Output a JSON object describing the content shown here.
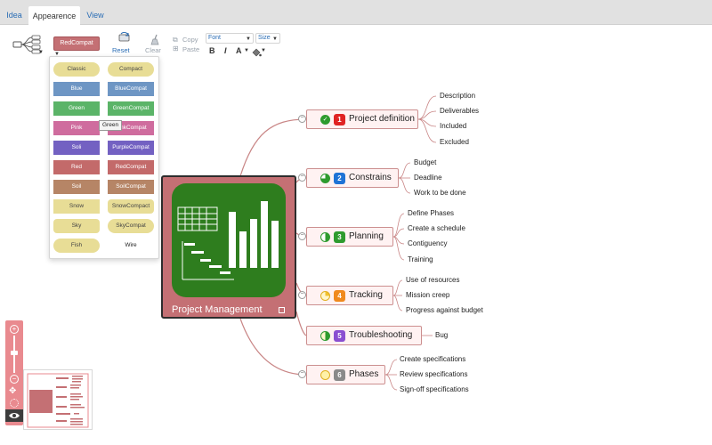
{
  "tabs": [
    {
      "label": "Idea"
    },
    {
      "label": "Appearence"
    },
    {
      "label": "View"
    }
  ],
  "toolbar": {
    "style_label": "RedCompat",
    "reset_label": "Reset",
    "clear_label": "Clear",
    "copy_label": "Copy",
    "paste_label": "Paste",
    "font_label": "Font",
    "size_label": "Size",
    "bold_label": "B",
    "italic_label": "I",
    "fontcolor_label": "A"
  },
  "palette": {
    "items": [
      {
        "label": "Classic",
        "color": "#e8dd96",
        "pill": true
      },
      {
        "label": "Compact",
        "color": "#e8dd96",
        "pill": true
      },
      {
        "label": "Blue",
        "color": "#6e96c4",
        "pill": false
      },
      {
        "label": "BlueCompat",
        "color": "#6e96c4",
        "pill": false
      },
      {
        "label": "Green",
        "color": "#5bb468",
        "pill": false
      },
      {
        "label": "GreenCompat",
        "color": "#5bb468",
        "pill": false
      },
      {
        "label": "Pink",
        "color": "#cf6c9e",
        "pill": false
      },
      {
        "label": "PinkCompat",
        "color": "#cf6c9e",
        "pill": false
      },
      {
        "label": "Soli",
        "color": "#7361c2",
        "pill": false
      },
      {
        "label": "PurpleCompat",
        "color": "#7361c2",
        "pill": false
      },
      {
        "label": "Red",
        "color": "#c36a6a",
        "pill": false
      },
      {
        "label": "RedCompat",
        "color": "#c36a6a",
        "pill": false
      },
      {
        "label": "Soil",
        "color": "#b68566",
        "pill": false
      },
      {
        "label": "SoilCompat",
        "color": "#b68566",
        "pill": false
      },
      {
        "label": "Snow",
        "color": "#e8dd96",
        "pill": false
      },
      {
        "label": "SnowCompact",
        "color": "#e8dd96",
        "pill": false
      },
      {
        "label": "Sky",
        "color": "#e8dd96",
        "pill": false
      },
      {
        "label": "SkyCompat",
        "color": "#e8dd96",
        "pill": true
      },
      {
        "label": "Fish",
        "color": "#e8dd96",
        "pill": true
      },
      {
        "label": "Wire",
        "color": "transparent",
        "pill": false
      }
    ],
    "tooltip": "Green"
  },
  "mindmap": {
    "central_title": "Project Management",
    "branches": [
      {
        "num": "1",
        "num_color": "#e02323",
        "icon": "checkmark-icon",
        "icon_color": "#2e9b2e",
        "label": "Project definition",
        "leaves": [
          "Description",
          "Deliverables",
          "Included",
          "Excluded"
        ]
      },
      {
        "num": "2",
        "num_color": "#1f73d6",
        "icon": "progress-75-icon",
        "icon_color": "#2e9b2e",
        "label": "Constrains",
        "leaves": [
          "Budget",
          "Deadline",
          "Work to be done"
        ]
      },
      {
        "num": "3",
        "num_color": "#2e9b2e",
        "icon": "progress-50-icon",
        "icon_color": "#2e9b2e",
        "label": "Planning",
        "leaves": [
          "Define Phases",
          "Create a schedule",
          "Contiguency",
          "Training"
        ]
      },
      {
        "num": "4",
        "num_color": "#f08a1e",
        "icon": "progress-25-icon",
        "icon_color": "#f2c12e",
        "label": "Tracking",
        "leaves": [
          "Use of resources",
          "Mission creep",
          "Progress against budget"
        ]
      },
      {
        "num": "5",
        "num_color": "#8a4fd1",
        "icon": "progress-50-icon",
        "icon_color": "#2e9b2e",
        "label": "Troubleshooting",
        "leaves": [
          "Bug"
        ]
      },
      {
        "num": "6",
        "num_color": "#8a8a8a",
        "icon": "progress-0-icon",
        "icon_color": "#f2c12e",
        "label": "Phases",
        "leaves": [
          "Create specifications",
          "Review specifications",
          "Sign-off specifications"
        ]
      }
    ]
  },
  "colors": {
    "accent": "#c47074",
    "node_border": "#cc8f8f",
    "node_fill": "#fff2f2",
    "central_image": "#2e7d1e",
    "link": "#2a6db5"
  }
}
